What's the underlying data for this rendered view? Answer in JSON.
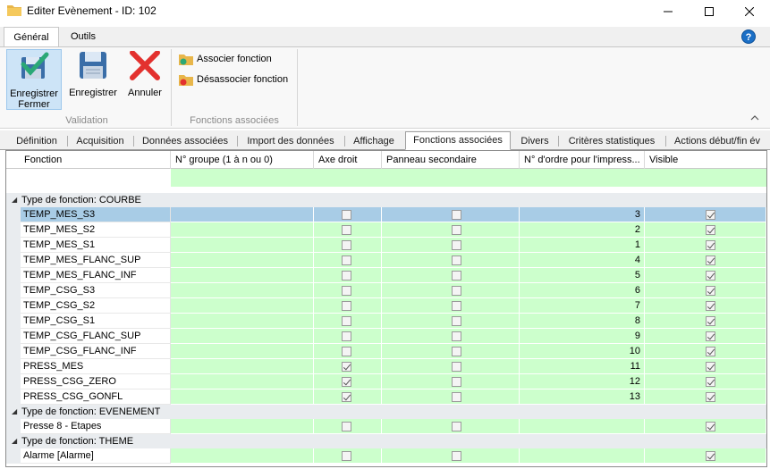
{
  "window": {
    "title": "Editer Evènement - ID: 102",
    "minimize_icon": "minimize-icon",
    "maximize_icon": "maximize-icon",
    "close_icon": "close-icon"
  },
  "ribbon_tabs": [
    "Général",
    "Outils"
  ],
  "ribbon": {
    "save_close_line1": "Enregistrer",
    "save_close_line2": "Fermer",
    "save_label": "Enregistrer",
    "cancel_label": "Annuler",
    "validation_group": "Validation",
    "associate_label": "Associer fonction",
    "dissociate_label": "Désassocier fonction",
    "functions_group": "Fonctions associées"
  },
  "page_tabs": [
    "Définition",
    "Acquisition",
    "Données associées",
    "Import des données",
    "Affichage",
    "Fonctions associées",
    "Divers",
    "Critères statistiques",
    "Actions début/fin év"
  ],
  "grid": {
    "columns": [
      "Fonction",
      "N° groupe (1 à n ou 0)",
      "Axe droit",
      "Panneau secondaire",
      "N° d'ordre pour l'impress...",
      "Visible"
    ],
    "groups": [
      {
        "label": "Type de fonction: COURBE",
        "rows": [
          {
            "name": "TEMP_MES_S3",
            "axe": false,
            "panneau": false,
            "ordre": "3",
            "visible": true,
            "selected": true
          },
          {
            "name": "TEMP_MES_S2",
            "axe": false,
            "panneau": false,
            "ordre": "2",
            "visible": true
          },
          {
            "name": "TEMP_MES_S1",
            "axe": false,
            "panneau": false,
            "ordre": "1",
            "visible": true
          },
          {
            "name": "TEMP_MES_FLANC_SUP",
            "axe": false,
            "panneau": false,
            "ordre": "4",
            "visible": true
          },
          {
            "name": "TEMP_MES_FLANC_INF",
            "axe": false,
            "panneau": false,
            "ordre": "5",
            "visible": true
          },
          {
            "name": "TEMP_CSG_S3",
            "axe": false,
            "panneau": false,
            "ordre": "6",
            "visible": true
          },
          {
            "name": "TEMP_CSG_S2",
            "axe": false,
            "panneau": false,
            "ordre": "7",
            "visible": true
          },
          {
            "name": "TEMP_CSG_S1",
            "axe": false,
            "panneau": false,
            "ordre": "8",
            "visible": true
          },
          {
            "name": "TEMP_CSG_FLANC_SUP",
            "axe": false,
            "panneau": false,
            "ordre": "9",
            "visible": true
          },
          {
            "name": "TEMP_CSG_FLANC_INF",
            "axe": false,
            "panneau": false,
            "ordre": "10",
            "visible": true
          },
          {
            "name": "PRESS_MES",
            "axe": true,
            "panneau": false,
            "ordre": "11",
            "visible": true
          },
          {
            "name": "PRESS_CSG_ZERO",
            "axe": true,
            "panneau": false,
            "ordre": "12",
            "visible": true
          },
          {
            "name": "PRESS_CSG_GONFL",
            "axe": true,
            "panneau": false,
            "ordre": "13",
            "visible": true
          }
        ]
      },
      {
        "label": "Type de fonction: EVENEMENT",
        "rows": [
          {
            "name": "Presse 8 - Etapes",
            "axe": false,
            "panneau": false,
            "ordre": "",
            "visible": true
          }
        ]
      },
      {
        "label": "Type de fonction: THEME",
        "rows": [
          {
            "name": "Alarme [Alarme]",
            "axe": false,
            "panneau": false,
            "ordre": "",
            "visible": true
          }
        ]
      }
    ]
  },
  "colors": {
    "cell_green": "#ccffcc",
    "selected_row": "#a8cce6",
    "group_bg": "#e9ecef"
  }
}
